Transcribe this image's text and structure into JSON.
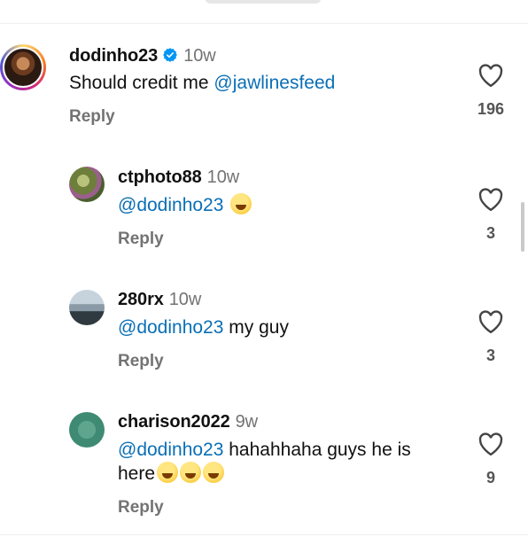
{
  "comments": [
    {
      "username": "dodinho23",
      "verified": true,
      "time": "10w",
      "text_prefix": "Should credit me ",
      "mention": "@jawlinesfeed",
      "text_suffix": "",
      "reply_label": "Reply",
      "likes": "196",
      "avatar": "profile-photo-man"
    },
    {
      "username": "ctphoto88",
      "time": "10w",
      "mention": "@dodinho23",
      "text_suffix": " ",
      "emoji": [
        "star-struck-emoji"
      ],
      "reply_label": "Reply",
      "likes": "3",
      "avatar": "profile-photo-flowers"
    },
    {
      "username": "280rx",
      "time": "10w",
      "mention": "@dodinho23",
      "text_suffix": " my guy",
      "reply_label": "Reply",
      "likes": "3",
      "avatar": "profile-photo-person"
    },
    {
      "username": "charison2022",
      "time": "9w",
      "mention": "@dodinho23",
      "text_suffix": " hahahhaha guys he is",
      "text_line2": "here",
      "emoji": [
        "rolling-laughing-emoji",
        "joy-emoji",
        "rolling-laughing-emoji"
      ],
      "reply_label": "Reply",
      "likes": "9",
      "avatar": "profile-photo-green"
    }
  ],
  "colors": {
    "mention": "#0a6fb5",
    "muted": "#737373",
    "verified": "#0095f6"
  }
}
